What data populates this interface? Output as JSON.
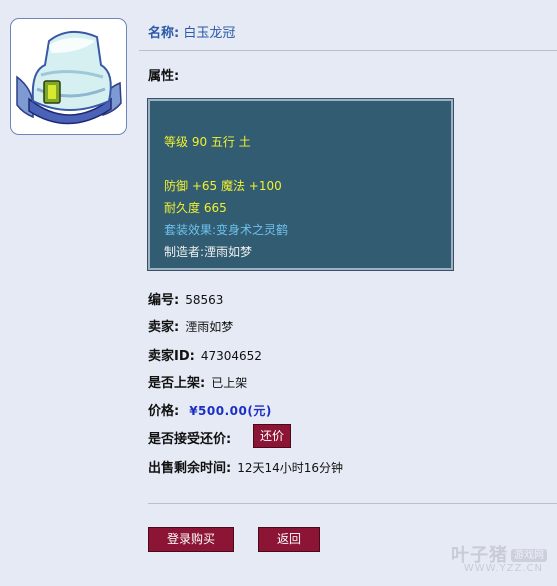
{
  "item": {
    "name_label": "名称:",
    "name_value": "白玉龙冠",
    "icon": "jade-dragon-crown-icon"
  },
  "attributes": {
    "label": "属性:",
    "lines": [
      "等级 90 五行 土",
      "防御 +65 魔法 +100",
      "耐久度 665",
      "套装效果:变身术之灵鹤",
      "制造者:湮雨如梦"
    ]
  },
  "fields": {
    "serial_label": "编号:",
    "serial_value": "58563",
    "seller_label": "卖家:",
    "seller_value": "湮雨如梦",
    "seller_id_label": "卖家ID:",
    "seller_id_value": "47304652",
    "listed_label": "是否上架:",
    "listed_value": "已上架",
    "price_label": "价格:",
    "price_value": "¥500.00(元)",
    "counter_label": "是否接受还价:",
    "counter_button": "还价",
    "time_label": "出售剩余时间:",
    "time_value": "12天14小时16分钟"
  },
  "actions": {
    "login_buy": "登录购买",
    "back": "返回"
  },
  "watermark": {
    "brand": "叶子猪",
    "badge": "游戏网",
    "url": "WWW.YZZ.CN"
  },
  "colors": {
    "page_bg": "#e6eaf5",
    "attr_box_bg": "#315c72",
    "attr_yellow": "#f2f22e",
    "attr_blue": "#6fc2ec",
    "button_bg": "#8c1535",
    "price_blue": "#1b2fc4",
    "name_blue": "#2a5aa8"
  }
}
